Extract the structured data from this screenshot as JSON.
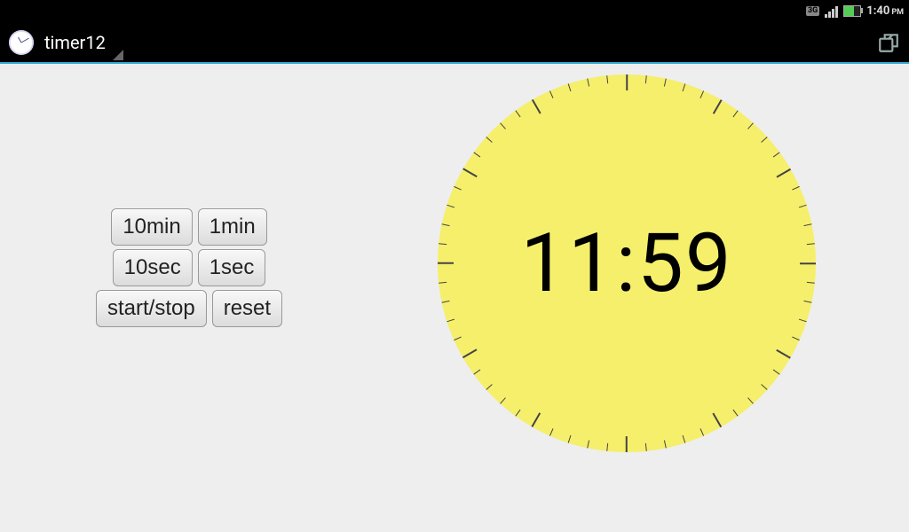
{
  "status_bar": {
    "network_badge": "3G",
    "clock_time": "1:40",
    "clock_period": "PM"
  },
  "title_bar": {
    "app_name": "timer12"
  },
  "buttons": {
    "ten_min": "10min",
    "one_min": "1min",
    "ten_sec": "10sec",
    "one_sec": "1sec",
    "start_stop": "start/stop",
    "reset": "reset"
  },
  "timer": {
    "display": "11:59"
  },
  "clock_face": {
    "color": "#f5ef6b",
    "tick_count": 60
  }
}
